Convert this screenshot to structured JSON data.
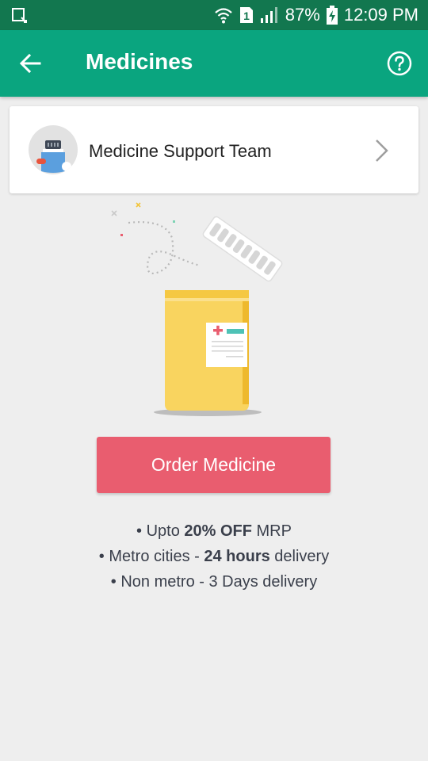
{
  "status_bar": {
    "battery": "87%",
    "time": "12:09 PM",
    "sim_slot": "1",
    "icons": [
      "screenshot-icon",
      "wifi-icon",
      "sim-1-icon",
      "signal-icon",
      "battery-charging-icon"
    ]
  },
  "app_bar": {
    "title": "Medicines",
    "back_icon": "arrow-back-icon",
    "help_icon": "help-circle-icon"
  },
  "support_card": {
    "title": "Medicine Support Team",
    "chevron_icon": "chevron-right-icon"
  },
  "order_button": {
    "label": "Order Medicine"
  },
  "features": [
    {
      "prefix": "• Upto ",
      "bold": "20% OFF",
      "suffix": " MRP"
    },
    {
      "prefix": "• Metro cities - ",
      "bold": "24 hours",
      "suffix": " delivery"
    },
    {
      "prefix": "• Non metro - 3 Days delivery",
      "bold": "",
      "suffix": ""
    }
  ],
  "colors": {
    "status_bar": "#12774f",
    "app_bar": "#0aa57f",
    "button": "#e95d6f",
    "background": "#eeeeee"
  }
}
